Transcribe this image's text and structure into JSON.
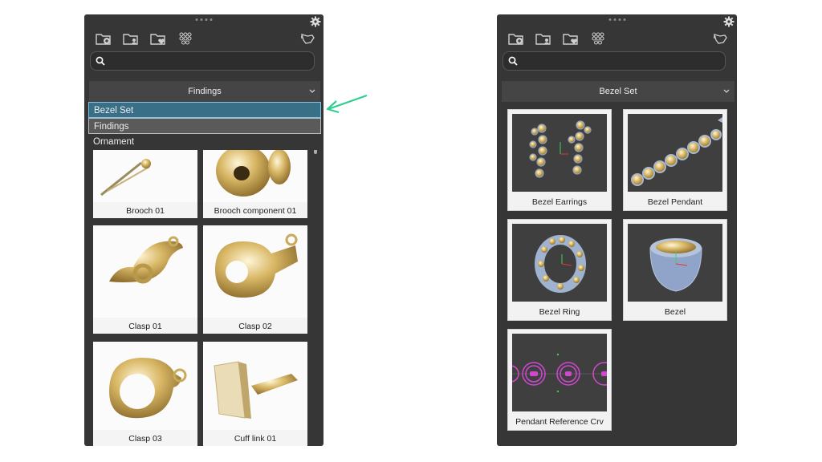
{
  "left_panel": {
    "toolbar_icons": [
      "folder-add-icon",
      "folder-user-icon",
      "folder-heart-icon",
      "gem-grid-icon",
      "hand-pointer-icon"
    ],
    "settings_icon": "gear-icon",
    "search": {
      "placeholder": "",
      "icon": "search-icon"
    },
    "category_dropdown": {
      "selected": "Findings",
      "icon": "chevron-down-icon"
    },
    "dropdown_options": [
      "Bezel Set",
      "Findings",
      "Ornament"
    ],
    "items": [
      "Brooch 01",
      "Brooch component 01",
      "Clasp 01",
      "Clasp 02",
      "Clasp 03",
      "Cuff link 01"
    ]
  },
  "right_panel": {
    "toolbar_icons": [
      "folder-add-icon",
      "folder-user-icon",
      "folder-heart-icon",
      "gem-grid-icon",
      "hand-pointer-icon"
    ],
    "settings_icon": "gear-icon",
    "search": {
      "placeholder": "",
      "icon": "search-icon"
    },
    "category_dropdown": {
      "selected": "Bezel Set",
      "icon": "chevron-down-icon"
    },
    "items": [
      "Bezel Earrings",
      "Bezel Pendant",
      "Bezel Ring",
      "Bezel",
      "Pendant Reference Crv"
    ]
  },
  "annotation": {
    "icon": "arrow-left-icon",
    "color": "#2ecf8f"
  },
  "colors": {
    "panel": "#363636",
    "selected_option": "#3a6f88",
    "gold": "#d9b866"
  }
}
